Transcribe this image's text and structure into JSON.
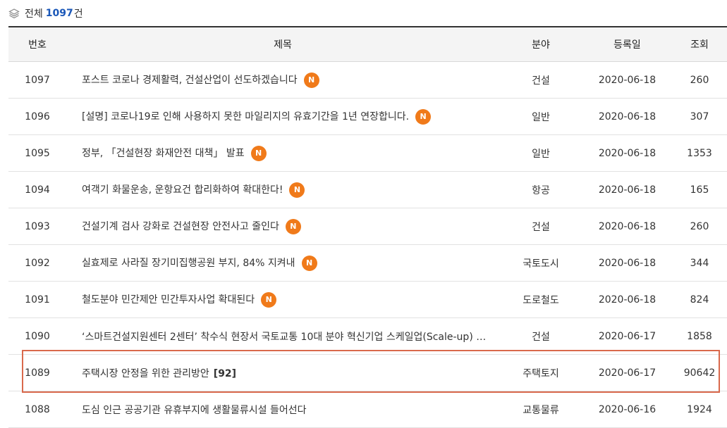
{
  "summary": {
    "label": "전체",
    "count": "1097",
    "unit": "건"
  },
  "table": {
    "headers": {
      "no": "번호",
      "title": "제목",
      "category": "분야",
      "date": "등록일",
      "views": "조회"
    },
    "rows": [
      {
        "no": "1097",
        "title": "포스트 코로나 경제활력, 건설산업이 선도하겠습니다",
        "is_new": true,
        "badge": "N",
        "comments": "",
        "category": "건설",
        "date": "2020-06-18",
        "views": "260"
      },
      {
        "no": "1096",
        "title": "[설명] 코로나19로 인해 사용하지 못한 마일리지의 유효기간을 1년 연장합니다.",
        "is_new": true,
        "badge": "N",
        "comments": "",
        "category": "일반",
        "date": "2020-06-18",
        "views": "307"
      },
      {
        "no": "1095",
        "title": "정부, 「건설현장 화재안전 대책」 발표",
        "is_new": true,
        "badge": "N",
        "comments": "",
        "category": "일반",
        "date": "2020-06-18",
        "views": "1353"
      },
      {
        "no": "1094",
        "title": "여객기 화물운송, 운항요건 합리화하여 확대한다!",
        "is_new": true,
        "badge": "N",
        "comments": "",
        "category": "항공",
        "date": "2020-06-18",
        "views": "165"
      },
      {
        "no": "1093",
        "title": "건설기계 검사 강화로 건설현장 안전사고 줄인다",
        "is_new": true,
        "badge": "N",
        "comments": "",
        "category": "건설",
        "date": "2020-06-18",
        "views": "260"
      },
      {
        "no": "1092",
        "title": "실효제로 사라질 장기미집행공원 부지, 84% 지켜내",
        "is_new": true,
        "badge": "N",
        "comments": "",
        "category": "국토도시",
        "date": "2020-06-18",
        "views": "344"
      },
      {
        "no": "1091",
        "title": "철도분야 민간제안 민간투자사업 확대된다",
        "is_new": true,
        "badge": "N",
        "comments": "",
        "category": "도로철도",
        "date": "2020-06-18",
        "views": "824"
      },
      {
        "no": "1090",
        "title": "‘스마트건설지원센터 2센터’ 착수식 현장서 국토교통 10대 분야 혁신기업 스케일업(Scale-up) …",
        "is_new": false,
        "badge": "",
        "comments": "",
        "category": "건설",
        "date": "2020-06-17",
        "views": "1858"
      },
      {
        "no": "1089",
        "title": "주택시장 안정을 위한 관리방안",
        "is_new": false,
        "badge": "",
        "comments": "[92]",
        "category": "주택토지",
        "date": "2020-06-17",
        "views": "90642"
      },
      {
        "no": "1088",
        "title": "도심 인근 공공기관 유휴부지에 생활물류시설 들어선다",
        "is_new": false,
        "badge": "",
        "comments": "",
        "category": "교통물류",
        "date": "2020-06-16",
        "views": "1924"
      }
    ]
  },
  "icons": {
    "summary_icon": "layers-icon"
  },
  "colors": {
    "accent_count": "#1a57b8",
    "new_badge": "#f07a1a",
    "highlight_border": "#d9694c"
  }
}
